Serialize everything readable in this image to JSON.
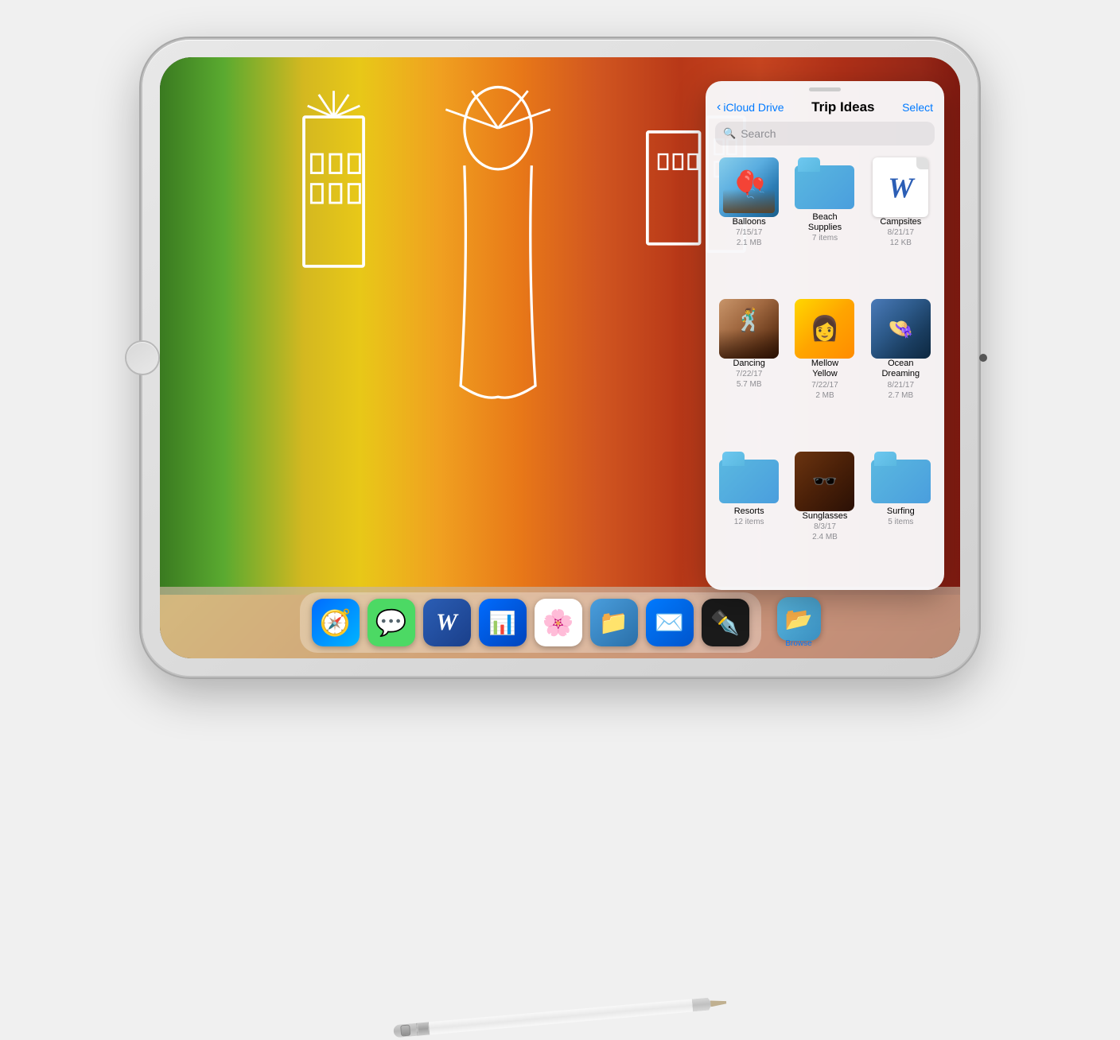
{
  "page": {
    "background_color": "#f0f0f0"
  },
  "ipad": {
    "screen_bg": "colorful wall photo"
  },
  "icloud_panel": {
    "handle_visible": true,
    "back_label": "iCloud Drive",
    "title": "Trip Ideas",
    "select_label": "Select",
    "search_placeholder": "Search",
    "files": [
      {
        "id": "balloons",
        "name": "Balloons",
        "type": "photo",
        "meta_line1": "7/15/17",
        "meta_line2": "2.1 MB"
      },
      {
        "id": "beach-supplies",
        "name": "Beach Supplies",
        "type": "folder",
        "meta_line1": "7 items",
        "meta_line2": "",
        "folder_color": "#4A9EDD"
      },
      {
        "id": "campsites",
        "name": "Campsites",
        "type": "word-doc",
        "meta_line1": "8/21/17",
        "meta_line2": "12 KB"
      },
      {
        "id": "dancing",
        "name": "Dancing",
        "type": "photo",
        "meta_line1": "7/22/17",
        "meta_line2": "5.7 MB"
      },
      {
        "id": "mellow-yellow",
        "name": "Mellow Yellow",
        "type": "photo",
        "meta_line1": "7/22/17",
        "meta_line2": "2 MB"
      },
      {
        "id": "ocean-dreaming",
        "name": "Ocean Dreaming",
        "type": "photo",
        "meta_line1": "8/21/17",
        "meta_line2": "2.7 MB"
      },
      {
        "id": "resorts",
        "name": "Resorts",
        "type": "folder",
        "meta_line1": "12 items",
        "meta_line2": "",
        "folder_color": "#4A9EDD"
      },
      {
        "id": "sunglasses",
        "name": "Sunglasses",
        "type": "photo",
        "meta_line1": "8/3/17",
        "meta_line2": "2.4 MB"
      },
      {
        "id": "surfing",
        "name": "Surfing",
        "type": "folder",
        "meta_line1": "5 items",
        "meta_line2": "",
        "folder_color": "#4A9EDD"
      }
    ]
  },
  "dock": {
    "apps": [
      {
        "id": "safari",
        "label": "Safari",
        "emoji": "🧭",
        "bg": "#006CFF"
      },
      {
        "id": "messages",
        "label": "Messages",
        "emoji": "💬",
        "bg": "#4CD964"
      },
      {
        "id": "word",
        "label": "Word",
        "emoji": "W",
        "bg": "#2B5EB5",
        "text": true
      },
      {
        "id": "keynote",
        "label": "Keynote",
        "emoji": "📊",
        "bg": "#006CFF"
      },
      {
        "id": "photos",
        "label": "Photos",
        "emoji": "🌸",
        "bg": "#fff"
      },
      {
        "id": "files",
        "label": "Files",
        "emoji": "📁",
        "bg": "#4A9EDD"
      },
      {
        "id": "mail",
        "label": "Mail",
        "emoji": "✉️",
        "bg": "#007AFF"
      },
      {
        "id": "pencil-app",
        "label": "Pencil",
        "emoji": "✒️",
        "bg": "#1a1a1a"
      }
    ],
    "browse_label": "Browse",
    "browse_icon": "📂"
  }
}
